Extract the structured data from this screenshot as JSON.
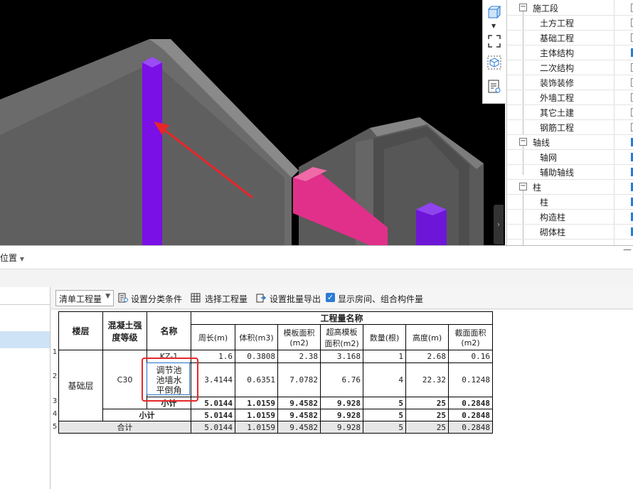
{
  "tree": {
    "items": [
      {
        "label": "施工段",
        "level": 0,
        "expanded": true,
        "checked": false
      },
      {
        "label": "土方工程",
        "level": 1,
        "checked": false
      },
      {
        "label": "基础工程",
        "level": 1,
        "checked": false
      },
      {
        "label": "主体结构",
        "level": 1,
        "checked": true
      },
      {
        "label": "二次结构",
        "level": 1,
        "checked": false
      },
      {
        "label": "装饰装修",
        "level": 1,
        "checked": false
      },
      {
        "label": "外墙工程",
        "level": 1,
        "checked": false
      },
      {
        "label": "其它土建",
        "level": 1,
        "checked": false
      },
      {
        "label": "钢筋工程",
        "level": 1,
        "checked": false
      },
      {
        "label": "轴线",
        "level": 0,
        "expanded": true,
        "checked": true
      },
      {
        "label": "轴网",
        "level": 1,
        "checked": true
      },
      {
        "label": "辅助轴线",
        "level": 1,
        "checked": true
      },
      {
        "label": "柱",
        "level": 0,
        "expanded": true,
        "checked": true
      },
      {
        "label": "柱",
        "level": 1,
        "checked": true
      },
      {
        "label": "构造柱",
        "level": 1,
        "checked": true
      },
      {
        "label": "砌体柱",
        "level": 1,
        "checked": true
      }
    ],
    "expand_symbol": "−"
  },
  "splitter": {
    "position_label": "位置",
    "minimize_glyph": "—"
  },
  "toolbar": {
    "dropdown_value": "清单工程量",
    "set_category": "设置分类条件",
    "select_quantity": "选择工程量",
    "batch_export": "设置批量导出",
    "show_rooms": "显示房间、组合构件量",
    "show_rooms_checked": true
  },
  "table": {
    "headers": {
      "floor": "楼层",
      "grade": "混凝土强度等级",
      "name": "名称",
      "group": "工程量名称",
      "cols": [
        "周长(m)",
        "体积(m3)",
        "模板面积(m2)",
        "超高模板面积(m2)",
        "数量(根)",
        "高度(m)",
        "截面面积(m2)"
      ]
    },
    "row_numbers": [
      "1",
      "2",
      "3",
      "4",
      "5"
    ],
    "floor_value": "基础层",
    "grade_value": "C30",
    "rows": [
      {
        "name": "KZ-1",
        "values": [
          "1.6",
          "0.3808",
          "2.38",
          "3.168",
          "1",
          "2.68",
          "0.16"
        ]
      },
      {
        "name": "调节池池墙水平倒角",
        "values": [
          "3.4144",
          "0.6351",
          "7.0782",
          "6.76",
          "4",
          "22.32",
          "0.1248"
        ]
      },
      {
        "name": "小计",
        "values": [
          "5.0144",
          "1.0159",
          "9.4582",
          "9.928",
          "5",
          "25",
          "0.2848"
        ]
      },
      {
        "name": "小计",
        "values": [
          "5.0144",
          "1.0159",
          "9.4582",
          "9.928",
          "5",
          "25",
          "0.2848"
        ]
      },
      {
        "name": "合计",
        "values": [
          "5.0144",
          "1.0159",
          "9.4582",
          "9.928",
          "5",
          "25",
          "0.2848"
        ]
      }
    ]
  },
  "colors": {
    "column_purple": "#7a0fe6",
    "beam_magenta": "#e0308a",
    "arrow_red": "#e8262a",
    "wall_gray": "#6e6e6e"
  }
}
